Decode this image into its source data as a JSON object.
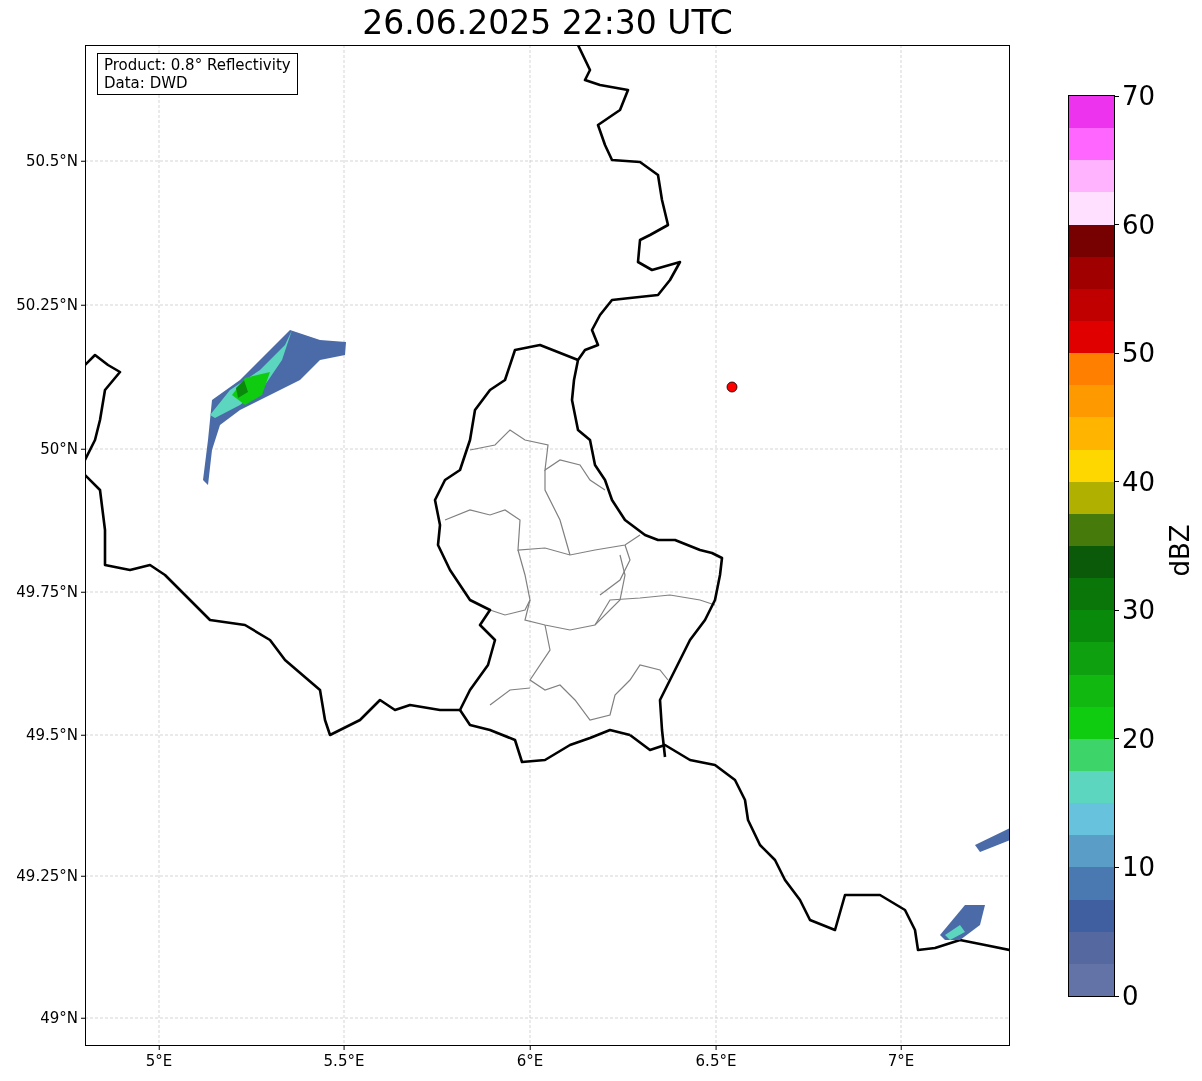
{
  "title": "26.06.2025 22:30 UTC",
  "info_box": [
    "Product: 0.8° Reflectivity",
    "Data: DWD"
  ],
  "map": {
    "xticks": [
      "5°E",
      "5.5°E",
      "6°E",
      "6.5°E",
      "7°E"
    ],
    "yticks": [
      "50.5°N",
      "50.25°N",
      "50°N",
      "49.75°N",
      "49.5°N",
      "49.25°N",
      "49°N"
    ],
    "marker": {
      "color": "#ff0000"
    }
  },
  "colorbar": {
    "label": "dBZ",
    "ticks": [
      "70",
      "60",
      "50",
      "40",
      "30",
      "20",
      "10",
      "0"
    ],
    "bins": [
      {
        "color": "#ee33ee"
      },
      {
        "color": "#ff66ff"
      },
      {
        "color": "#ffb3ff"
      },
      {
        "color": "#ffe0ff"
      },
      {
        "color": "#770000"
      },
      {
        "color": "#a00000"
      },
      {
        "color": "#c00000"
      },
      {
        "color": "#e00000"
      },
      {
        "color": "#ff7f00"
      },
      {
        "color": "#ff9900"
      },
      {
        "color": "#ffb400"
      },
      {
        "color": "#ffd700"
      },
      {
        "color": "#b0b000"
      },
      {
        "color": "#467a0a"
      },
      {
        "color": "#0a5a0a"
      },
      {
        "color": "#0a760a"
      },
      {
        "color": "#0a8a0a"
      },
      {
        "color": "#0ea00e"
      },
      {
        "color": "#10b810"
      },
      {
        "color": "#10cc10"
      },
      {
        "color": "#3dd46a"
      },
      {
        "color": "#5dd6c0"
      },
      {
        "color": "#66c2dd"
      },
      {
        "color": "#5a9ec8"
      },
      {
        "color": "#4a78b0"
      },
      {
        "color": "#405fa0"
      },
      {
        "color": "#5568a0"
      },
      {
        "color": "#6373a8"
      }
    ]
  }
}
